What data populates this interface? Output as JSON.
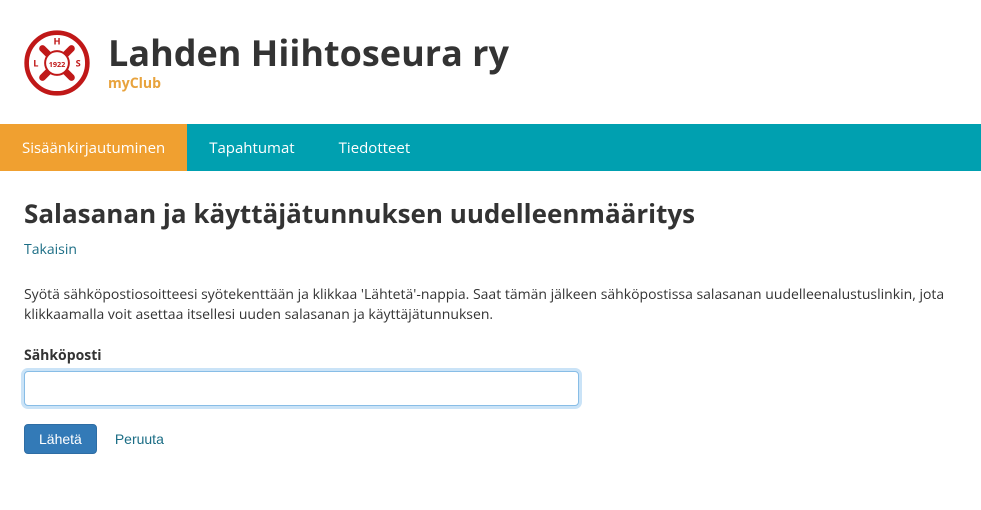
{
  "header": {
    "club_name": "Lahden Hiihtoseura ry",
    "subtitle": "myClub",
    "logo": {
      "letters": {
        "top": "H",
        "left": "L",
        "right": "S"
      },
      "year": "1922"
    }
  },
  "nav": {
    "items": [
      {
        "label": "Sisäänkirjautuminen",
        "active": true
      },
      {
        "label": "Tapahtumat",
        "active": false
      },
      {
        "label": "Tiedotteet",
        "active": false
      }
    ]
  },
  "page": {
    "heading": "Salasanan ja käyttäjätunnuksen uudelleenmääritys",
    "back_label": "Takaisin",
    "instructions": "Syötä sähköpostiosoitteesi syötekenttään ja klikkaa 'Lähtetä'-nappia. Saat tämän jälkeen sähköpostissa salasanan uudelleenalustuslinkin, jota klikkaamalla voit asettaa itsellesi uuden salasanan ja käyttäjätunnuksen."
  },
  "form": {
    "email_label": "Sähköposti",
    "email_value": "",
    "submit_label": "Lähetä",
    "cancel_label": "Peruuta"
  }
}
